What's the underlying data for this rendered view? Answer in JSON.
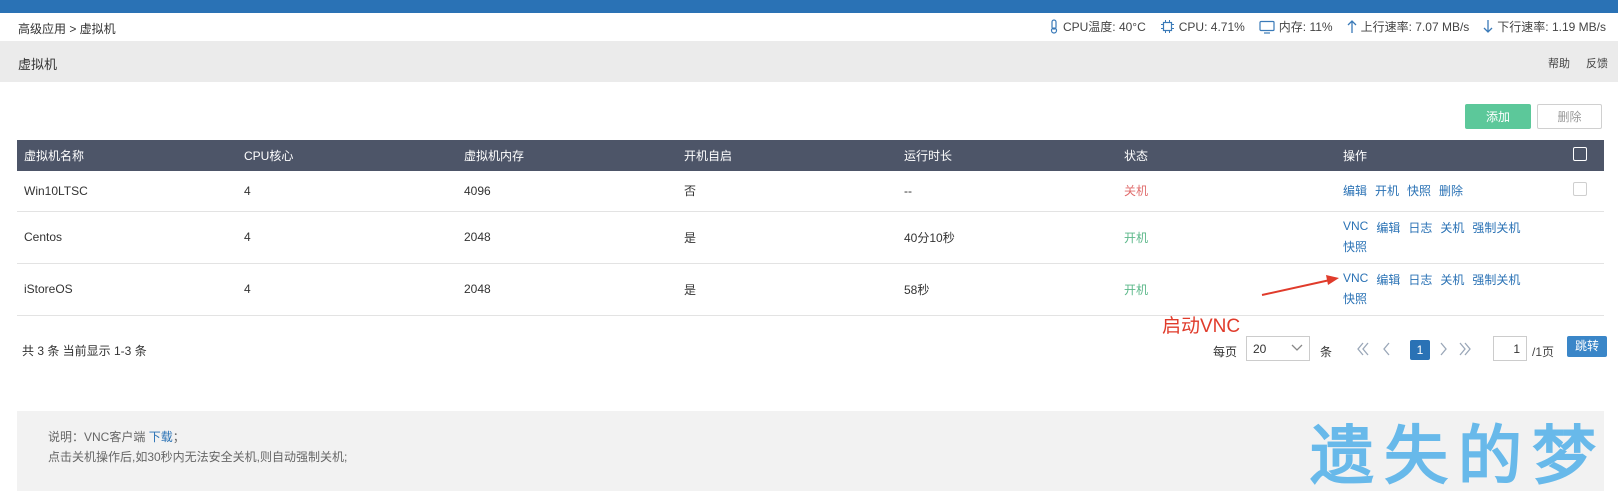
{
  "breadcrumb": "高级应用 > 虚拟机",
  "stats": {
    "cpu_temp": "CPU温度: 40°C",
    "cpu": "CPU: 4.71%",
    "memory": "内存: 11%",
    "upload": "上行速率: 7.07 MB/s",
    "download": "下行速率: 1.19 MB/s"
  },
  "page_title": "虚拟机",
  "title_links": {
    "help": "帮助",
    "feedback": "反馈"
  },
  "toolbar": {
    "add": "添加",
    "delete": "删除"
  },
  "table": {
    "headers": [
      "虚拟机名称",
      "CPU核心",
      "虚拟机内存",
      "开机自启",
      "运行时长",
      "状态",
      "操作"
    ],
    "rows": [
      {
        "name": "Win10LTSC",
        "cpu": "4",
        "mem": "4096",
        "autostart": "否",
        "uptime": "--",
        "status": "关机",
        "ops": [
          "编辑",
          "开机",
          "快照",
          "删除"
        ]
      },
      {
        "name": "Centos",
        "cpu": "4",
        "mem": "2048",
        "autostart": "是",
        "uptime": "40分10秒",
        "status": "开机",
        "ops": [
          "VNC",
          "编辑",
          "日志",
          "关机",
          "强制关机",
          "快照"
        ]
      },
      {
        "name": "iStoreOS",
        "cpu": "4",
        "mem": "2048",
        "autostart": "是",
        "uptime": "58秒",
        "status": "开机",
        "ops": [
          "VNC",
          "编辑",
          "日志",
          "关机",
          "强制关机",
          "快照"
        ]
      }
    ]
  },
  "summary": "共 3 条 当前显示 1-3 条",
  "annotation": "启动VNC",
  "pager": {
    "per_page_label": "每页",
    "per_page_value": "20",
    "unit": "条",
    "current_page": "1",
    "jump_value": "1",
    "total_pages": "/1页",
    "jump_label": "跳转"
  },
  "notes": {
    "line1_prefix": "说明：VNC客户端",
    "line1_link": "下载",
    "line1_suffix": "；",
    "line2": "点击关机操作后,如30秒内无法安全关机,则自动强制关机;"
  },
  "watermark": "遗失的梦",
  "colors": {
    "topbar": "#2a72b5",
    "table_header": "#4d5568",
    "add_button": "#5cc89a",
    "status_off": "#e06c6c",
    "status_on": "#5cb88a",
    "link": "#2a72b5",
    "annotation": "#e03b2b"
  }
}
